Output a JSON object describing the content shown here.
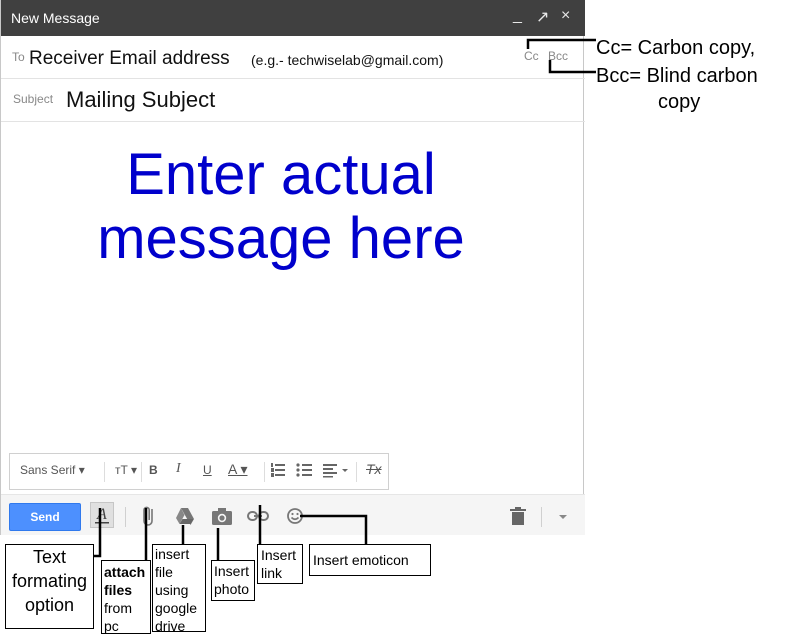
{
  "window": {
    "title": "New Message",
    "controls": [
      "_",
      "↗",
      "×"
    ]
  },
  "to": {
    "label": "To",
    "value": "Receiver Email address",
    "example": "(e.g.- techwiselab@gmail.com)",
    "cc": "Cc",
    "bcc": "Bcc"
  },
  "subject": {
    "label": "Subject",
    "value": "Mailing Subject"
  },
  "body": {
    "line1": "Enter actual",
    "line2": "message here"
  },
  "format_toolbar": {
    "font": "Sans Serif",
    "size": "тT",
    "bold": "B",
    "italic": "I",
    "underline": "U",
    "text_color": "A",
    "remove_format": "Tx"
  },
  "bottom_toolbar": {
    "send": "Send"
  },
  "annotations": {
    "cc_note": "Cc= Carbon copy,",
    "bcc_note_1": "Bcc= Blind carbon",
    "bcc_note_2": "copy",
    "text_format": [
      "Text",
      "formating",
      "option"
    ],
    "attach_bold_1": "attach",
    "attach_bold_2": "files",
    "attach_rest_1": "from",
    "attach_rest_2": "pc",
    "drive": [
      "insert",
      "file",
      "using",
      "google",
      "drive"
    ],
    "photo": [
      "Insert",
      "photo"
    ],
    "link": [
      "Insert",
      "link"
    ],
    "emoticon": "Insert emoticon"
  },
  "colors": {
    "titlebar": "#404040",
    "send_button": "#4d90fe",
    "message_text": "#0000cc"
  }
}
